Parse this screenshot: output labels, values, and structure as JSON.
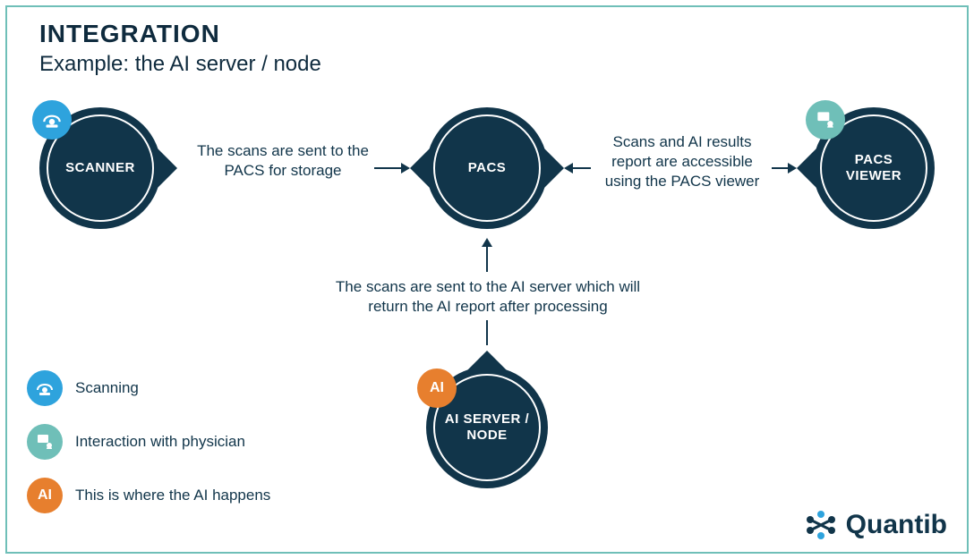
{
  "header": {
    "title": "INTEGRATION",
    "subtitle": "Example: the AI server / node"
  },
  "nodes": {
    "scanner": {
      "label": "SCANNER",
      "icon_name": "scanner-icon"
    },
    "pacs": {
      "label": "PACS"
    },
    "viewer": {
      "label": "PACS VIEWER",
      "icon_name": "viewer-icon"
    },
    "ai_server": {
      "label": "AI SERVER / NODE",
      "icon_label": "AI",
      "icon_name": "ai-badge"
    }
  },
  "edges": {
    "scanner_to_pacs": "The scans are sent to the PACS for storage",
    "pacs_to_ai": "The scans are sent to the AI server which will return the AI report after processing",
    "pacs_to_viewer": "Scans and AI results report are accessible using the PACS viewer"
  },
  "legend": [
    {
      "icon_class": "icon-blue",
      "icon_name": "scanner-icon",
      "text": "Scanning"
    },
    {
      "icon_class": "icon-teal",
      "icon_name": "viewer-icon",
      "text": "Interaction with physician"
    },
    {
      "icon_class": "icon-orange",
      "icon_name": "ai-badge",
      "icon_label": "AI",
      "text": "This is where the AI happens"
    }
  ],
  "brand": {
    "name": "Quantib"
  },
  "colors": {
    "node": "#11354a",
    "scanner_icon": "#2ea3dd",
    "viewer_icon": "#6fbfb8",
    "ai_icon": "#e77f2e",
    "frame": "#6fbfb8"
  }
}
